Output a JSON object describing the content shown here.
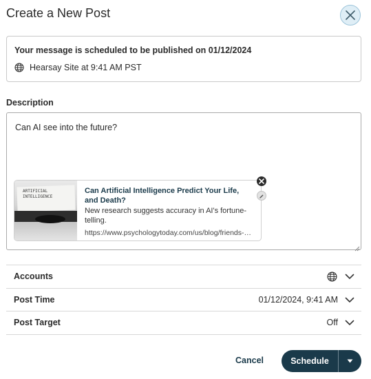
{
  "dialog": {
    "title": "Create a New Post",
    "close_icon": "close-icon"
  },
  "schedule_notice": {
    "message": "Your message is scheduled to be published on 01/12/2024",
    "site_icon": "globe-icon",
    "site_text": "Hearsay Site at 9:41 AM PST"
  },
  "description": {
    "label": "Description",
    "text": "Can AI see into the future?"
  },
  "link_preview": {
    "title": "Can Artificial Intelligence Predict Your Life, and Death?",
    "description": "New research suggests accuracy in AI's fortune-telling.",
    "url": "https://www.psychologytoday.com/us/blog/friends-with-technology",
    "image_text": "ARTIFICIAL\nINTELLIGENCE",
    "remove_icon": "close-icon",
    "edit_icon": "pencil-icon"
  },
  "sections": [
    {
      "label": "Accounts",
      "value": "",
      "icon": "globe-icon"
    },
    {
      "label": "Post Time",
      "value": "01/12/2024, 9:41 AM"
    },
    {
      "label": "Post Target",
      "value": "Off"
    }
  ],
  "footer": {
    "cancel_label": "Cancel",
    "schedule_label": "Schedule"
  },
  "colors": {
    "primary": "#1a3a4a",
    "border": "#c9c9c9",
    "close_bg": "#dfeef6"
  }
}
